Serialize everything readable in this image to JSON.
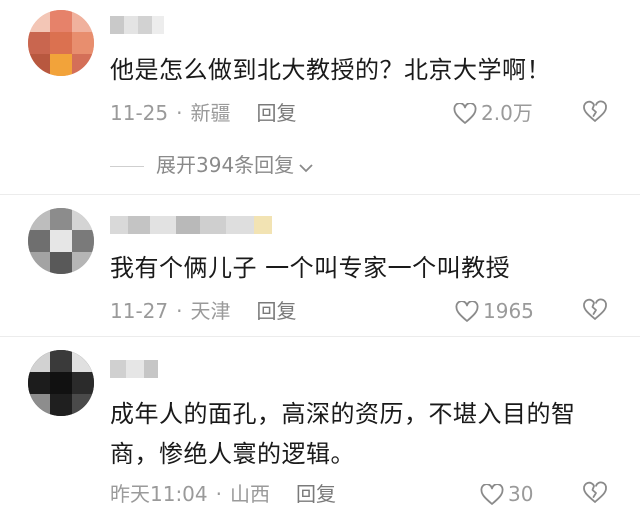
{
  "comments": [
    {
      "text": "他是怎么做到北大教授的？北京大学啊！",
      "date": "11-25",
      "location": "新疆",
      "reply": "回复",
      "likes": "2.0万"
    },
    {
      "text": "我有个俩儿子 一个叫专家一个叫教授",
      "date": "11-27",
      "location": "天津",
      "reply": "回复",
      "likes": "1965"
    },
    {
      "text": "成年人的面孔，高深的资历，不堪入目的智商，惨绝人寰的逻辑。",
      "date": "昨天11:04",
      "location": "山西",
      "reply": "回复",
      "likes": "30"
    }
  ],
  "expand_replies": "展开394条回复",
  "meta_separator": "·"
}
